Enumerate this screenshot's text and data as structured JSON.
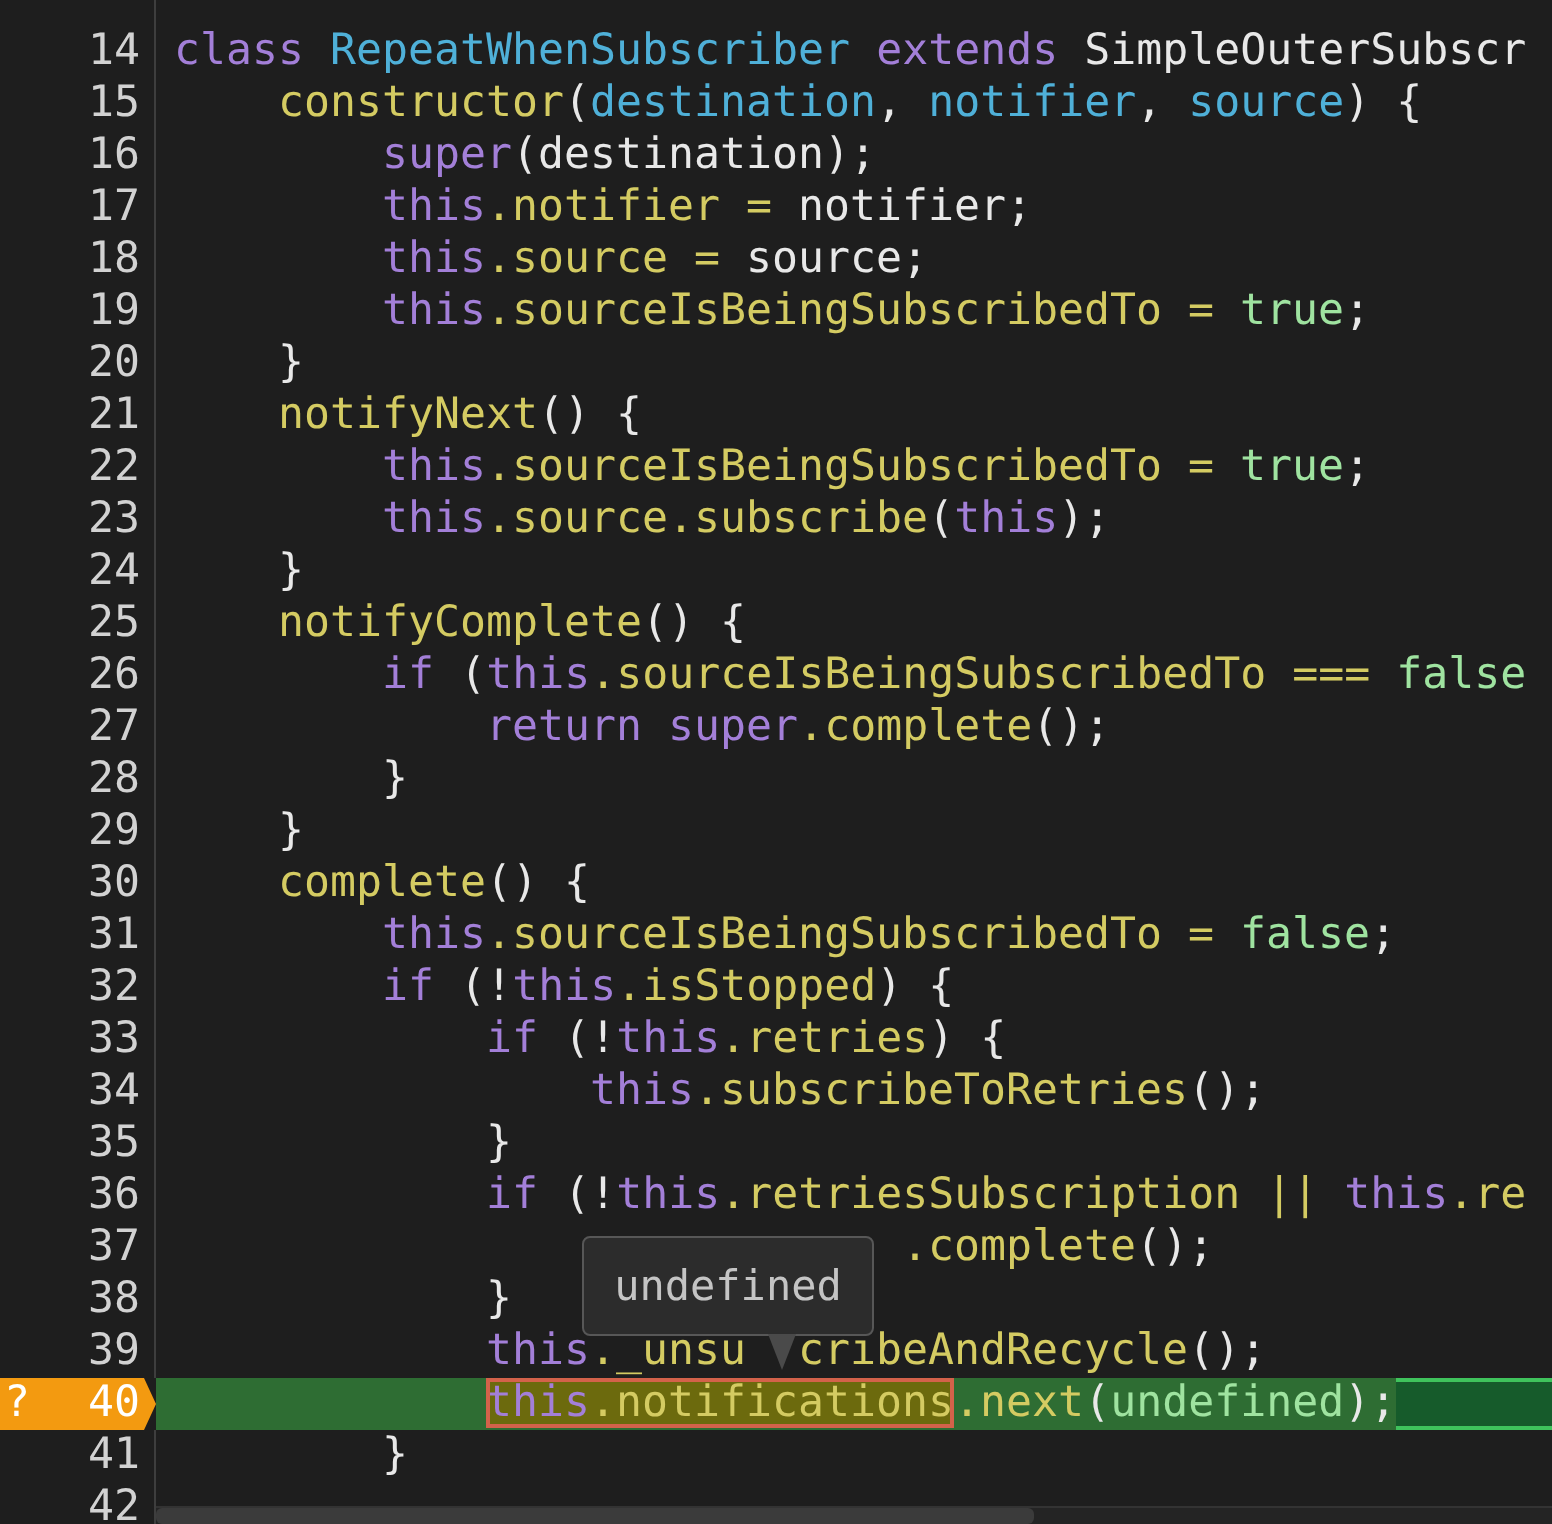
{
  "editor": {
    "lines": [
      {
        "number": "14",
        "current": false,
        "tokens": [
          {
            "kind": "keyword",
            "text": "class"
          },
          {
            "kind": "type",
            "text": " RepeatWhenSubscriber"
          },
          {
            "kind": "keyword",
            "text": " extends"
          },
          {
            "kind": "plain",
            "text": " SimpleOuterSubscr"
          }
        ]
      },
      {
        "number": "15",
        "current": false,
        "tokens": [
          {
            "kind": "member",
            "text": "    constructor"
          },
          {
            "kind": "plain",
            "text": "("
          },
          {
            "kind": "param",
            "text": "destination"
          },
          {
            "kind": "plain",
            "text": ", "
          },
          {
            "kind": "param",
            "text": "notifier"
          },
          {
            "kind": "plain",
            "text": ", "
          },
          {
            "kind": "param",
            "text": "source"
          },
          {
            "kind": "plain",
            "text": ") {"
          }
        ]
      },
      {
        "number": "16",
        "current": false,
        "tokens": [
          {
            "kind": "keyword",
            "text": "        super"
          },
          {
            "kind": "plain",
            "text": "(destination);"
          }
        ]
      },
      {
        "number": "17",
        "current": false,
        "tokens": [
          {
            "kind": "keyword",
            "text": "        this"
          },
          {
            "kind": "member",
            "text": ".notifier = "
          },
          {
            "kind": "plain",
            "text": "notifier;"
          }
        ]
      },
      {
        "number": "18",
        "current": false,
        "tokens": [
          {
            "kind": "keyword",
            "text": "        this"
          },
          {
            "kind": "member",
            "text": ".source = "
          },
          {
            "kind": "plain",
            "text": "source;"
          }
        ]
      },
      {
        "number": "19",
        "current": false,
        "tokens": [
          {
            "kind": "keyword",
            "text": "        this"
          },
          {
            "kind": "member",
            "text": ".sourceIsBeingSubscribedTo = "
          },
          {
            "kind": "literal",
            "text": "true"
          },
          {
            "kind": "plain",
            "text": ";"
          }
        ]
      },
      {
        "number": "20",
        "current": false,
        "tokens": [
          {
            "kind": "plain",
            "text": "    }"
          }
        ]
      },
      {
        "number": "21",
        "current": false,
        "tokens": [
          {
            "kind": "member",
            "text": "    notifyNext"
          },
          {
            "kind": "plain",
            "text": "() {"
          }
        ]
      },
      {
        "number": "22",
        "current": false,
        "tokens": [
          {
            "kind": "keyword",
            "text": "        this"
          },
          {
            "kind": "member",
            "text": ".sourceIsBeingSubscribedTo = "
          },
          {
            "kind": "literal",
            "text": "true"
          },
          {
            "kind": "plain",
            "text": ";"
          }
        ]
      },
      {
        "number": "23",
        "current": false,
        "tokens": [
          {
            "kind": "keyword",
            "text": "        this"
          },
          {
            "kind": "member",
            "text": ".source.subscribe"
          },
          {
            "kind": "plain",
            "text": "("
          },
          {
            "kind": "keyword",
            "text": "this"
          },
          {
            "kind": "plain",
            "text": ");"
          }
        ]
      },
      {
        "number": "24",
        "current": false,
        "tokens": [
          {
            "kind": "plain",
            "text": "    }"
          }
        ]
      },
      {
        "number": "25",
        "current": false,
        "tokens": [
          {
            "kind": "member",
            "text": "    notifyComplete"
          },
          {
            "kind": "plain",
            "text": "() {"
          }
        ]
      },
      {
        "number": "26",
        "current": false,
        "tokens": [
          {
            "kind": "keyword",
            "text": "        if"
          },
          {
            "kind": "plain",
            "text": " ("
          },
          {
            "kind": "keyword",
            "text": "this"
          },
          {
            "kind": "member",
            "text": ".sourceIsBeingSubscribedTo === "
          },
          {
            "kind": "literal",
            "text": "false"
          }
        ]
      },
      {
        "number": "27",
        "current": false,
        "tokens": [
          {
            "kind": "keyword",
            "text": "            return"
          },
          {
            "kind": "keyword",
            "text": " super"
          },
          {
            "kind": "member",
            "text": ".complete"
          },
          {
            "kind": "plain",
            "text": "();"
          }
        ]
      },
      {
        "number": "28",
        "current": false,
        "tokens": [
          {
            "kind": "plain",
            "text": "        }"
          }
        ]
      },
      {
        "number": "29",
        "current": false,
        "tokens": [
          {
            "kind": "plain",
            "text": "    }"
          }
        ]
      },
      {
        "number": "30",
        "current": false,
        "tokens": [
          {
            "kind": "member",
            "text": "    complete"
          },
          {
            "kind": "plain",
            "text": "() {"
          }
        ]
      },
      {
        "number": "31",
        "current": false,
        "tokens": [
          {
            "kind": "keyword",
            "text": "        this"
          },
          {
            "kind": "member",
            "text": ".sourceIsBeingSubscribedTo = "
          },
          {
            "kind": "literal",
            "text": "false"
          },
          {
            "kind": "plain",
            "text": ";"
          }
        ]
      },
      {
        "number": "32",
        "current": false,
        "tokens": [
          {
            "kind": "keyword",
            "text": "        if"
          },
          {
            "kind": "plain",
            "text": " (!"
          },
          {
            "kind": "keyword",
            "text": "this"
          },
          {
            "kind": "member",
            "text": ".isStopped"
          },
          {
            "kind": "plain",
            "text": ") {"
          }
        ]
      },
      {
        "number": "33",
        "current": false,
        "tokens": [
          {
            "kind": "keyword",
            "text": "            if"
          },
          {
            "kind": "plain",
            "text": " (!"
          },
          {
            "kind": "keyword",
            "text": "this"
          },
          {
            "kind": "member",
            "text": ".retries"
          },
          {
            "kind": "plain",
            "text": ") {"
          }
        ]
      },
      {
        "number": "34",
        "current": false,
        "tokens": [
          {
            "kind": "keyword",
            "text": "                this"
          },
          {
            "kind": "member",
            "text": ".subscribeToRetries"
          },
          {
            "kind": "plain",
            "text": "();"
          }
        ]
      },
      {
        "number": "35",
        "current": false,
        "tokens": [
          {
            "kind": "plain",
            "text": "            }"
          }
        ]
      },
      {
        "number": "36",
        "current": false,
        "tokens": [
          {
            "kind": "keyword",
            "text": "            if"
          },
          {
            "kind": "plain",
            "text": " (!"
          },
          {
            "kind": "keyword",
            "text": "this"
          },
          {
            "kind": "member",
            "text": ".retriesSubscription || "
          },
          {
            "kind": "keyword",
            "text": "this"
          },
          {
            "kind": "member",
            "text": ".re"
          }
        ]
      },
      {
        "number": "37",
        "current": false,
        "tokens": [
          {
            "kind": "member",
            "text": "                            .complete"
          },
          {
            "kind": "plain",
            "text": "();"
          }
        ]
      },
      {
        "number": "38",
        "current": false,
        "tokens": [
          {
            "kind": "plain",
            "text": "            }"
          }
        ]
      },
      {
        "number": "39",
        "current": false,
        "tokens": [
          {
            "kind": "keyword",
            "text": "            this"
          },
          {
            "kind": "member",
            "text": "._unsu"
          }
        ],
        "tokens_after_pointer": [
          {
            "kind": "member",
            "text": "cribeAndRecycle"
          },
          {
            "kind": "plain",
            "text": "();"
          }
        ]
      },
      {
        "number": "40",
        "current": true,
        "marker": "?",
        "tokens": [
          {
            "kind": "keyword",
            "text": "            this",
            "hovered": true
          },
          {
            "kind": "member",
            "text": ".notifications",
            "hovered": true
          },
          {
            "kind": "member",
            "text": ".next",
            "hovered": false
          },
          {
            "kind": "plain",
            "text": "(",
            "hovered": false
          },
          {
            "kind": "literal",
            "text": "undefined",
            "hovered": false
          },
          {
            "kind": "plain",
            "text": ");",
            "hovered": false
          }
        ]
      },
      {
        "number": "41",
        "current": false,
        "tokens": [
          {
            "kind": "plain",
            "text": "        }"
          }
        ]
      },
      {
        "number": "42",
        "current": false
      }
    ],
    "tooltip": {
      "text": "undefined"
    }
  }
}
